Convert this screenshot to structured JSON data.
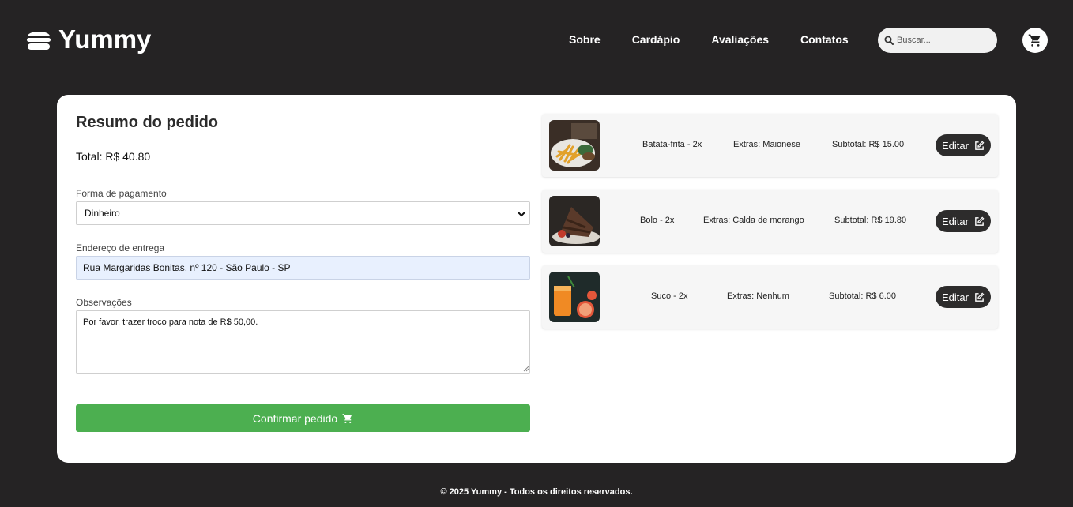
{
  "brand": {
    "name": "Yummy",
    "logo_icon": "burger-icon"
  },
  "nav": {
    "items": [
      "Sobre",
      "Cardápio",
      "Avaliações",
      "Contatos"
    ]
  },
  "search": {
    "placeholder": "Buscar...",
    "icon": "search-icon"
  },
  "cart": {
    "icon": "cart-icon"
  },
  "summary": {
    "title": "Resumo do pedido",
    "total": "Total: R$ 40.80",
    "payment_label": "Forma de pagamento",
    "payment_value": "Dinheiro",
    "address_label": "Endereço de entrega",
    "address_value": "Rua Margaridas Bonitas, nº 120 - São Paulo - SP",
    "notes_label": "Observações",
    "notes_value": "Por favor, trazer troco para nota de R$ 50,00.",
    "confirm_label": "Confirmar pedido",
    "confirm_icon": "cart-icon"
  },
  "items": [
    {
      "name": "Batata-frita - 2x",
      "extras": "Extras: Maionese",
      "subtotal": "Subtotal: R$ 15.00",
      "edit_label": "Editar",
      "image": "fries-image"
    },
    {
      "name": "Bolo - 2x",
      "extras": "Extras: Calda de morango",
      "subtotal": "Subtotal: R$ 19.80",
      "edit_label": "Editar",
      "image": "cake-image"
    },
    {
      "name": "Suco - 2x",
      "extras": "Extras: Nenhum",
      "subtotal": "Subtotal: R$ 6.00",
      "edit_label": "Editar",
      "image": "juice-image"
    }
  ],
  "footer": {
    "text": "© 2025 Yummy - Todos os direitos reservados."
  },
  "colors": {
    "background": "#252324",
    "card": "#ffffff",
    "confirm": "#4caf50",
    "edit_button": "#2d2c2c",
    "address_fill": "#e8f0fe"
  }
}
